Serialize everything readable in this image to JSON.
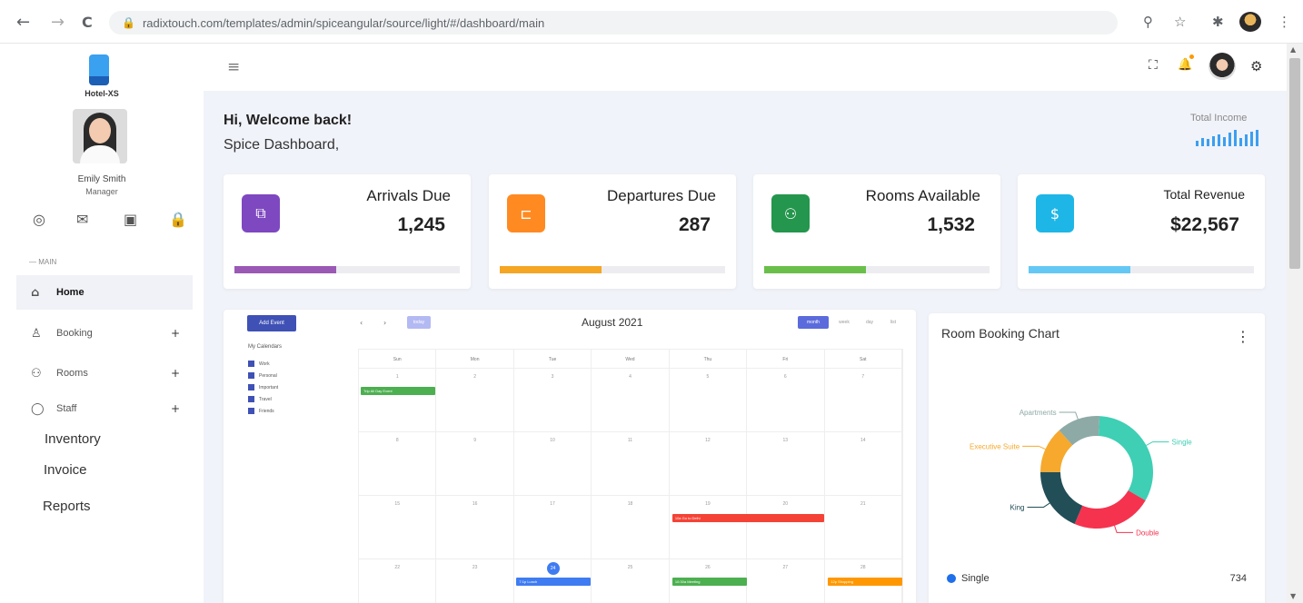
{
  "browser": {
    "url": "radixtouch.com/templates/admin/spiceangular/source/light/#/dashboard/main",
    "back_glyph": "←",
    "forward_glyph": "→",
    "reload_glyph": "C",
    "lock_glyph": "🔒",
    "zoom_glyph": "⚲",
    "star_glyph": "☆",
    "ext_glyph": "✱",
    "menu_glyph": "⋮"
  },
  "sidebar": {
    "brand": "Hotel-XS",
    "user_name": "Emily Smith",
    "user_role": "Manager",
    "quick_icons": [
      "◎",
      "✉",
      "▣",
      "🔒"
    ],
    "section_header": "— MAIN",
    "items": [
      {
        "label": "Home",
        "icon": "⌂",
        "active": true
      },
      {
        "label": "Booking",
        "icon": "♙",
        "plus": "+"
      },
      {
        "label": "Rooms",
        "icon": "⚇",
        "plus": "+"
      },
      {
        "label": "Staff",
        "icon": "◯",
        "plus": "+"
      }
    ],
    "plain_items": [
      "Inventory",
      "Invoice",
      "Reports"
    ]
  },
  "header": {
    "menu_glyph": "≡",
    "fullscreen_glyph": "⛶",
    "bell_glyph": "🔔",
    "settings_glyph": "⚙"
  },
  "welcome": {
    "greeting": "Hi, Welcome back!",
    "subtitle": "Spice Dashboard,",
    "income_label": "Total Income",
    "income_sparkline": [
      0.35,
      0.5,
      0.45,
      0.6,
      0.75,
      0.55,
      0.85,
      1.0,
      0.5,
      0.7,
      0.9,
      1.0
    ]
  },
  "stats": [
    {
      "label": "Arrivals Due",
      "value": "1,245",
      "icon": "⧉",
      "color": "#7e48c0",
      "bar_color": "#9b59b6",
      "progress": 0.45
    },
    {
      "label": "Departures Due",
      "value": "287",
      "icon": "⊏",
      "color": "#ff8a22",
      "bar_color": "#f5a623",
      "progress": 0.45
    },
    {
      "label": "Rooms Available",
      "value": "1,532",
      "icon": "⚇",
      "color": "#24964d",
      "bar_color": "#6abf4b",
      "progress": 0.45
    },
    {
      "label": "Total Revenue",
      "value": "$22,567",
      "icon": "$",
      "color": "#1eb6e6",
      "bar_color": "#64c8f5",
      "progress": 0.45
    }
  ],
  "calendar": {
    "add_event": "Add Event",
    "my_calendars": "My Calendars",
    "calendars": [
      "Work",
      "Personal",
      "Important",
      "Travel",
      "Friends"
    ],
    "prev": "‹",
    "next": "›",
    "today": "today",
    "month_title": "August 2021",
    "views": [
      "month",
      "week",
      "day",
      "list"
    ],
    "weekdays": [
      "Sun",
      "Mon",
      "Tue",
      "Wed",
      "Thu",
      "Fri",
      "Sat"
    ],
    "weeks": [
      [
        "1",
        "2",
        "3",
        "4",
        "5",
        "6",
        "7"
      ],
      [
        "8",
        "9",
        "10",
        "11",
        "12",
        "13",
        "14"
      ],
      [
        "15",
        "16",
        "17",
        "18",
        "19",
        "20",
        "21"
      ],
      [
        "22",
        "23",
        "24",
        "25",
        "26",
        "27",
        "28"
      ]
    ],
    "events": [
      {
        "label": "Trip All Day Event",
        "week": 0,
        "start": 0,
        "span": 1,
        "color": "#4caf50"
      },
      {
        "label": "10a Go to Delhi",
        "week": 2,
        "start": 4,
        "span": 2,
        "color": "#f44336"
      },
      {
        "label": "7:1p Lunch",
        "week": 3,
        "start": 2,
        "span": 1,
        "color": "#3f7cf2"
      },
      {
        "label": "10:30a Meeting",
        "week": 3,
        "start": 4,
        "span": 1,
        "color": "#4caf50"
      },
      {
        "label": "12p Shopping",
        "week": 3,
        "start": 6,
        "span": 1,
        "color": "#ff9800"
      }
    ],
    "today_date": "24"
  },
  "room_chart": {
    "title": "Room Booking Chart",
    "menu_glyph": "⋮",
    "legend_value": "734",
    "legend_label": "Single"
  },
  "chart_data": {
    "type": "pie",
    "title": "Room Booking Chart",
    "categories": [
      "Single",
      "Double",
      "King",
      "Executive Suite",
      "Apartments"
    ],
    "values": [
      734,
      520,
      420,
      300,
      280
    ],
    "colors": [
      "#3ecfb4",
      "#f5334f",
      "#224e57",
      "#f6a92d",
      "#8eaaa6"
    ]
  }
}
